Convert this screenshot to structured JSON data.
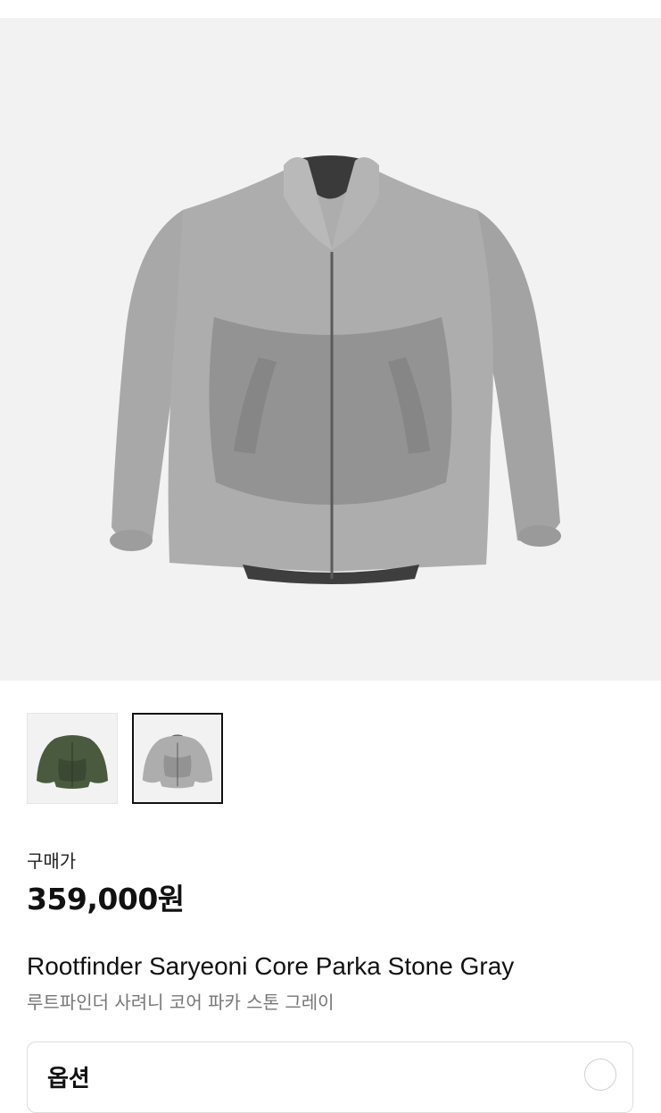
{
  "gallery": {
    "main_image": "jacket-stone-gray-photo",
    "thumbnails": [
      {
        "image": "jacket-olive-green-photo",
        "selected": false
      },
      {
        "image": "jacket-stone-gray-photo",
        "selected": true
      }
    ]
  },
  "price": {
    "label": "구매가",
    "value": "359,000원"
  },
  "product": {
    "name_en": "Rootfinder Saryeoni Core Parka Stone Gray",
    "name_ko": "루트파인더 사려니 코어 파카 스톤 그레이"
  },
  "option": {
    "label": "옵션",
    "icon": "chevron-down-icon"
  },
  "colors": {
    "hero_bg": "#f2f2f2",
    "jacket_gray": "#a9a9a9",
    "jacket_green": "#4a5a3e",
    "selected_border": "#111111"
  }
}
